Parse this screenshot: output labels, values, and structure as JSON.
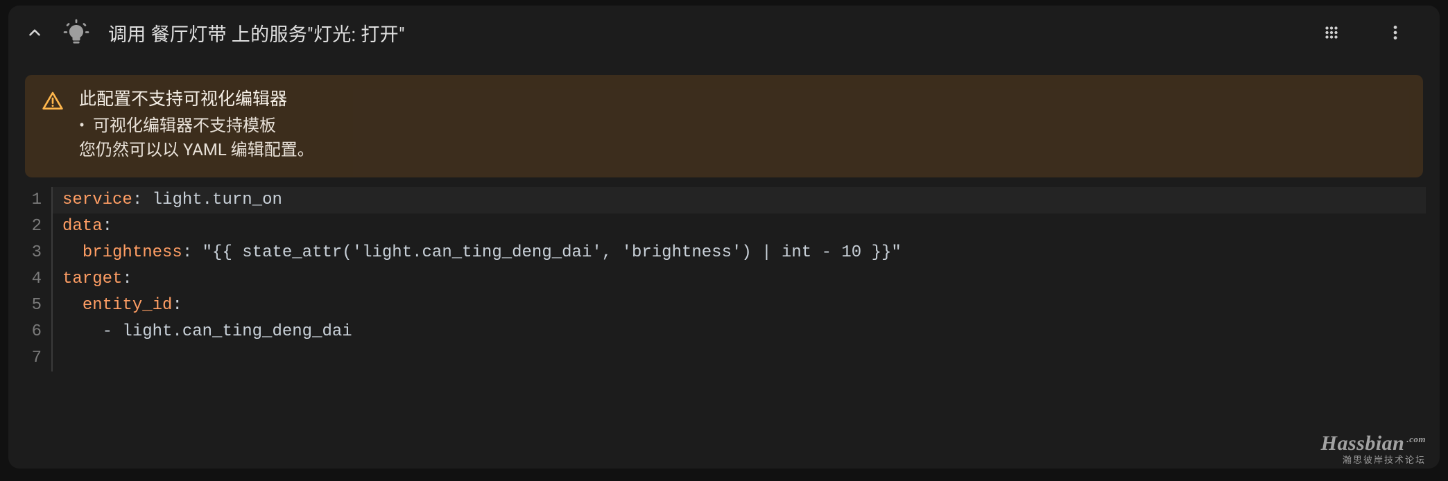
{
  "header": {
    "title": "调用 餐厅灯带 上的服务\"灯光: 打开\"",
    "icons": {
      "collapse": "chevron-up-icon",
      "lightbulb": "lightbulb-on-icon",
      "keypad": "dialpad-icon",
      "menu": "dots-vertical-icon"
    }
  },
  "warning": {
    "title": "此配置不支持可视化编辑器",
    "bullet": "可视化编辑器不支持模板",
    "footer": "您仍然可以以 YAML 编辑配置。"
  },
  "editor": {
    "line_start": 1,
    "line_count": 7,
    "yaml": {
      "l1_key": "service",
      "l1_val": "light.turn_on",
      "l2_key": "data",
      "l3_key": "brightness",
      "l3_val": "\"{{ state_attr('light.can_ting_deng_dai', 'brightness') | int - 10 }}\"",
      "l4_key": "target",
      "l5_key": "entity_id",
      "l6_dash": "-",
      "l6_val": "light.can_ting_deng_dai"
    }
  },
  "watermark": {
    "main": "Hassbian",
    "com": ".com",
    "sub": "瀚思彼岸技术论坛"
  },
  "colors": {
    "bg": "#111111",
    "card": "#1c1c1c",
    "warn_bg": "rgba(120,78,30,0.35)",
    "warn_icon": "#ffb74d",
    "yaml_key": "#ff9e64",
    "text": "#e0e0e0"
  }
}
